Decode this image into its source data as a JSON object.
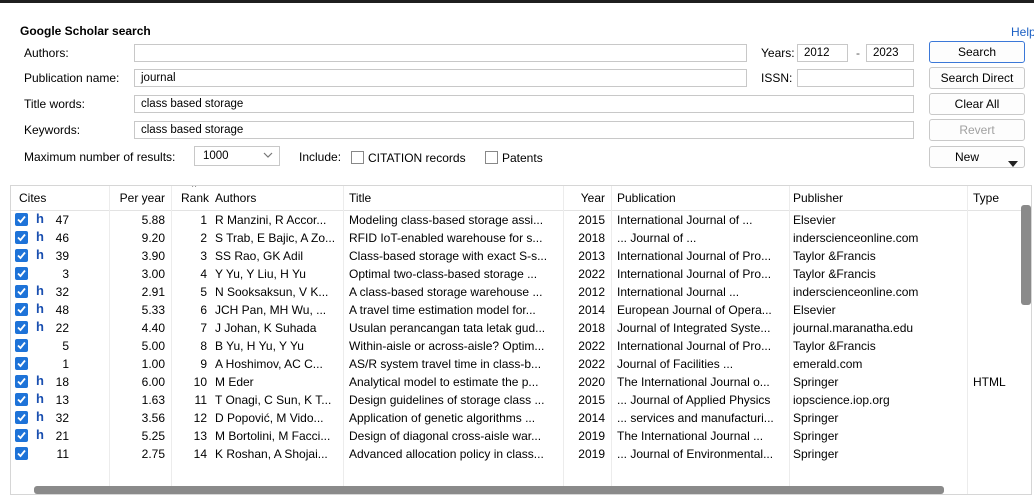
{
  "search_panel": {
    "title": "Google Scholar search",
    "help": "Help",
    "authors_label": "Authors:",
    "authors_value": "",
    "years_label": "Years:",
    "year_from": "2012",
    "year_sep": "-",
    "year_to": "2023",
    "pubname_label": "Publication name:",
    "pubname_value": "journal",
    "issn_label": "ISSN:",
    "issn_value": "",
    "title_words_label": "Title words:",
    "title_words_value": "class based storage",
    "keywords_label": "Keywords:",
    "keywords_value": "class based storage",
    "max_results_label": "Maximum number of results:",
    "max_results_value": "1000",
    "include_label": "Include:",
    "citation_records": "CITATION records",
    "patents": "Patents"
  },
  "buttons": {
    "search": "Search",
    "search_direct": "Search Direct",
    "clear_all": "Clear All",
    "revert": "Revert",
    "new": "New"
  },
  "table": {
    "columns": [
      "Cites",
      "Per year",
      "Rank",
      "Authors",
      "Title",
      "Year",
      "Publication",
      "Publisher",
      "Type"
    ],
    "rows": [
      {
        "cites": "47",
        "h": "h",
        "per_year": "5.88",
        "rank": "1",
        "authors": "R Manzini, R Accor...",
        "title": "Modeling class-based storage assi...",
        "year": "2015",
        "publication": "International Journal of ...",
        "publisher": "Elsevier",
        "type": ""
      },
      {
        "cites": "46",
        "h": "h",
        "per_year": "9.20",
        "rank": "2",
        "authors": "S Trab, E Bajic, A Zo...",
        "title": "RFID IoT-enabled warehouse for s...",
        "year": "2018",
        "publication": "... Journal of ...",
        "publisher": "inderscienceonline.com",
        "type": ""
      },
      {
        "cites": "39",
        "h": "h",
        "per_year": "3.90",
        "rank": "3",
        "authors": "SS Rao, GK Adil",
        "title": "Class-based storage with exact S-s...",
        "year": "2013",
        "publication": "International Journal of Pro...",
        "publisher": "Taylor &Francis",
        "type": ""
      },
      {
        "cites": "3",
        "h": "",
        "per_year": "3.00",
        "rank": "4",
        "authors": "Y Yu, Y Liu, H Yu",
        "title": "Optimal two-class-based storage ...",
        "year": "2022",
        "publication": "International Journal of Pro...",
        "publisher": "Taylor &Francis",
        "type": ""
      },
      {
        "cites": "32",
        "h": "h",
        "per_year": "2.91",
        "rank": "5",
        "authors": "N Sooksaksun, V K...",
        "title": "A class-based storage warehouse ...",
        "year": "2012",
        "publication": "International Journal ...",
        "publisher": "inderscienceonline.com",
        "type": ""
      },
      {
        "cites": "48",
        "h": "h",
        "per_year": "5.33",
        "rank": "6",
        "authors": "JCH Pan, MH Wu, ...",
        "title": "A travel time estimation model for...",
        "year": "2014",
        "publication": "European Journal of Opera...",
        "publisher": "Elsevier",
        "type": ""
      },
      {
        "cites": "22",
        "h": "h",
        "per_year": "4.40",
        "rank": "7",
        "authors": "J Johan, K Suhada",
        "title": "Usulan perancangan tata letak gud...",
        "year": "2018",
        "publication": "Journal of Integrated Syste...",
        "publisher": "journal.maranatha.edu",
        "type": ""
      },
      {
        "cites": "5",
        "h": "",
        "per_year": "5.00",
        "rank": "8",
        "authors": "B Yu, H Yu, Y Yu",
        "title": "Within-aisle or across-aisle? Optim...",
        "year": "2022",
        "publication": "International Journal of Pro...",
        "publisher": "Taylor &Francis",
        "type": ""
      },
      {
        "cites": "1",
        "h": "",
        "per_year": "1.00",
        "rank": "9",
        "authors": "A Hoshimov, AC C...",
        "title": "AS/R system travel time in class-b...",
        "year": "2022",
        "publication": "Journal of Facilities ...",
        "publisher": "emerald.com",
        "type": ""
      },
      {
        "cites": "18",
        "h": "h",
        "per_year": "6.00",
        "rank": "10",
        "authors": "M Eder",
        "title": "Analytical model to estimate the p...",
        "year": "2020",
        "publication": "The International Journal o...",
        "publisher": "Springer",
        "type": "HTML"
      },
      {
        "cites": "13",
        "h": "h",
        "per_year": "1.63",
        "rank": "11",
        "authors": "T Onagi, C Sun, K T...",
        "title": "Design guidelines of storage class ...",
        "year": "2015",
        "publication": "... Journal of Applied Physics",
        "publisher": "iopscience.iop.org",
        "type": ""
      },
      {
        "cites": "32",
        "h": "h",
        "per_year": "3.56",
        "rank": "12",
        "authors": "D Popović, M Vido...",
        "title": "Application of genetic algorithms ...",
        "year": "2014",
        "publication": "... services and manufacturi...",
        "publisher": "Springer",
        "type": ""
      },
      {
        "cites": "21",
        "h": "h",
        "per_year": "5.25",
        "rank": "13",
        "authors": "M Bortolini, M Facci...",
        "title": "Design of diagonal cross-aisle war...",
        "year": "2019",
        "publication": "The International Journal ...",
        "publisher": "Springer",
        "type": ""
      },
      {
        "cites": "11",
        "h": "",
        "per_year": "2.75",
        "rank": "14",
        "authors": "K Roshan, A Shojai...",
        "title": "Advanced allocation policy in class...",
        "year": "2019",
        "publication": "... Journal of Environmental...",
        "publisher": "Springer",
        "type": ""
      }
    ]
  },
  "colors": {
    "accent": "#1e73d8",
    "help_link": "#1a5fc4",
    "h_index": "#1a4fb0"
  }
}
